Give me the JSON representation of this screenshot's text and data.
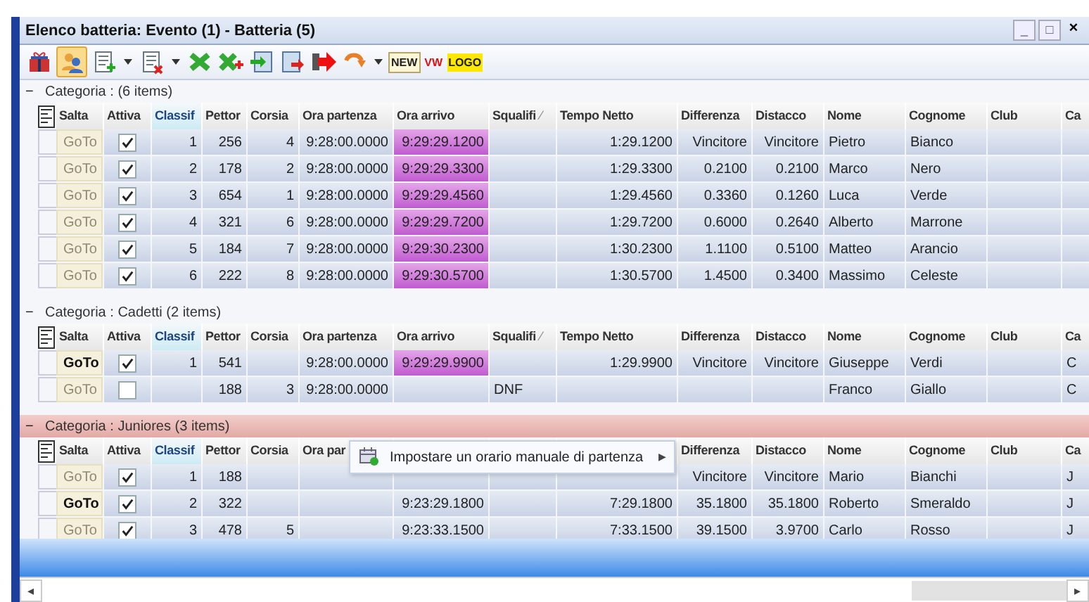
{
  "window": {
    "title": "Elenco batteria: Evento (1) - Batteria (5)",
    "controls": [
      "_",
      "□",
      "×"
    ]
  },
  "toolbar": {
    "text_buttons": [
      {
        "label": "NEW",
        "kind": "new"
      },
      {
        "label": "VW",
        "kind": "vw"
      },
      {
        "label": "LOGO",
        "kind": "logo"
      }
    ]
  },
  "groups": [
    {
      "label": "Categoria :  (6 items)",
      "expander": "−",
      "highlighted": false,
      "columns": [
        {
          "label": "Salta",
          "kind": "goto"
        },
        {
          "label": "Attiva",
          "kind": "check"
        },
        {
          "label": "Classif",
          "kind": "num",
          "sorted": true
        },
        {
          "label": "Pettor",
          "kind": "num"
        },
        {
          "label": "Corsia",
          "kind": "num"
        },
        {
          "label": "Ora partenza",
          "kind": "num"
        },
        {
          "label": "Ora arrivo",
          "kind": "arrival"
        },
        {
          "label": "Squalifi",
          "kind": "text",
          "mark": "⁄"
        },
        {
          "label": "Tempo Netto",
          "kind": "num"
        },
        {
          "label": "Differenza",
          "kind": "num"
        },
        {
          "label": "Distacco",
          "kind": "num"
        },
        {
          "label": "Nome",
          "kind": "text"
        },
        {
          "label": "Cognome",
          "kind": "text"
        },
        {
          "label": "Club",
          "kind": "text"
        },
        {
          "label": "Ca",
          "kind": "text"
        }
      ],
      "rows": [
        {
          "cells": [
            "GoTo",
            true,
            "1",
            "256",
            "4",
            "9:28:00.0000",
            "9:29:29.1200",
            null,
            "1:29.1200",
            "Vincitore",
            "Vincitore",
            "Pietro",
            "Bianco",
            null,
            null
          ],
          "goto_active": false,
          "arrival_marked": true
        },
        {
          "cells": [
            "GoTo",
            true,
            "2",
            "178",
            "2",
            "9:28:00.0000",
            "9:29:29.3300",
            null,
            "1:29.3300",
            "0.2100",
            "0.2100",
            "Marco",
            "Nero",
            null,
            null
          ],
          "goto_active": false,
          "arrival_marked": true
        },
        {
          "cells": [
            "GoTo",
            true,
            "3",
            "654",
            "1",
            "9:28:00.0000",
            "9:29:29.4560",
            null,
            "1:29.4560",
            "0.3360",
            "0.1260",
            "Luca",
            "Verde",
            null,
            null
          ],
          "goto_active": false,
          "arrival_marked": true
        },
        {
          "cells": [
            "GoTo",
            true,
            "4",
            "321",
            "6",
            "9:28:00.0000",
            "9:29:29.7200",
            null,
            "1:29.7200",
            "0.6000",
            "0.2640",
            "Alberto",
            "Marrone",
            null,
            null
          ],
          "goto_active": false,
          "arrival_marked": true
        },
        {
          "cells": [
            "GoTo",
            true,
            "5",
            "184",
            "7",
            "9:28:00.0000",
            "9:29:30.2300",
            null,
            "1:30.2300",
            "1.1100",
            "0.5100",
            "Matteo",
            "Arancio",
            null,
            null
          ],
          "goto_active": false,
          "arrival_marked": true
        },
        {
          "cells": [
            "GoTo",
            true,
            "6",
            "222",
            "8",
            "9:28:00.0000",
            "9:29:30.5700",
            null,
            "1:30.5700",
            "1.4500",
            "0.3400",
            "Massimo",
            "Celeste",
            null,
            null
          ],
          "goto_active": false,
          "arrival_marked": true
        }
      ]
    },
    {
      "label": "Categoria : Cadetti (2 items)",
      "expander": "−",
      "highlighted": false,
      "columns": [
        {
          "label": "Salta",
          "kind": "goto"
        },
        {
          "label": "Attiva",
          "kind": "check"
        },
        {
          "label": "Classif",
          "kind": "num",
          "sorted": true
        },
        {
          "label": "Pettor",
          "kind": "num"
        },
        {
          "label": "Corsia",
          "kind": "num"
        },
        {
          "label": "Ora partenza",
          "kind": "num"
        },
        {
          "label": "Ora arrivo",
          "kind": "arrival"
        },
        {
          "label": "Squalifi",
          "kind": "text",
          "mark": "⁄"
        },
        {
          "label": "Tempo Netto",
          "kind": "num"
        },
        {
          "label": "Differenza",
          "kind": "num"
        },
        {
          "label": "Distacco",
          "kind": "num"
        },
        {
          "label": "Nome",
          "kind": "text"
        },
        {
          "label": "Cognome",
          "kind": "text"
        },
        {
          "label": "Club",
          "kind": "text"
        },
        {
          "label": "Ca",
          "kind": "text"
        }
      ],
      "rows": [
        {
          "cells": [
            "GoTo",
            true,
            "1",
            "541",
            null,
            "9:28:00.0000",
            "9:29:29.9900",
            null,
            "1:29.9900",
            "Vincitore",
            "Vincitore",
            "Giuseppe",
            "Verdi",
            null,
            "C"
          ],
          "goto_active": true,
          "arrival_marked": true
        },
        {
          "cells": [
            "GoTo",
            false,
            null,
            "188",
            "3",
            "9:28:00.0000",
            null,
            "DNF",
            null,
            null,
            null,
            "Franco",
            "Giallo",
            null,
            "C"
          ],
          "goto_active": false,
          "arrival_marked": false
        }
      ]
    },
    {
      "label": "Categoria : Juniores (3 items)",
      "expander": "−",
      "highlighted": true,
      "columns": [
        {
          "label": "Salta",
          "kind": "goto"
        },
        {
          "label": "Attiva",
          "kind": "check"
        },
        {
          "label": "Classif",
          "kind": "num",
          "sorted": true
        },
        {
          "label": "Pettor",
          "kind": "num"
        },
        {
          "label": "Corsia",
          "kind": "num"
        },
        {
          "label": "Ora par",
          "kind": "num"
        },
        {
          "kind": "arrival"
        },
        {
          "kind": "text"
        },
        {
          "kind": "num"
        },
        {
          "label": "Differenza",
          "kind": "num"
        },
        {
          "label": "Distacco",
          "kind": "num"
        },
        {
          "label": "Nome",
          "kind": "text"
        },
        {
          "label": "Cognome",
          "kind": "text"
        },
        {
          "label": "Club",
          "kind": "text"
        },
        {
          "label": "Ca",
          "kind": "text"
        }
      ],
      "rows": [
        {
          "cells": [
            "GoTo",
            true,
            "1",
            "188",
            null,
            null,
            null,
            null,
            null,
            "Vincitore",
            "Vincitore",
            "Mario",
            "Bianchi",
            null,
            "J"
          ],
          "goto_active": false,
          "arrival_marked": false
        },
        {
          "cells": [
            "GoTo",
            true,
            "2",
            "322",
            null,
            null,
            "9:23:29.1800",
            null,
            "7:29.1800",
            "35.1800",
            "35.1800",
            "Roberto",
            "Smeraldo",
            null,
            "J"
          ],
          "goto_active": true,
          "arrival_marked": false
        },
        {
          "cells": [
            "GoTo",
            true,
            "3",
            "478",
            "5",
            null,
            "9:23:33.1500",
            null,
            "7:33.1500",
            "39.1500",
            "3.9700",
            "Carlo",
            "Rosso",
            null,
            "J"
          ],
          "goto_active": false,
          "arrival_marked": false
        }
      ]
    }
  ],
  "context_menu": {
    "items": [
      {
        "label": "Impostare un orario manuale di partenza",
        "submenu": "▶"
      }
    ]
  },
  "scrollbar": {
    "left_arrow": "◂",
    "right_arrow": "▸"
  }
}
